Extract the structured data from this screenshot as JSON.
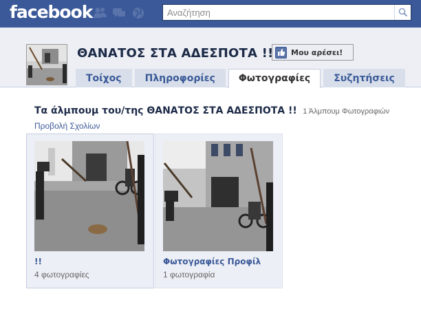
{
  "topbar": {
    "logo": "facebook",
    "search_placeholder": "Αναζήτηση",
    "icons": [
      "friend-requests-icon",
      "messages-icon",
      "notifications-globe-icon",
      "search-icon"
    ]
  },
  "page": {
    "title": "ΘΑΝΑΤΟΣ ΣΤΑ ΑΔΕΣΠΟΤΑ !!",
    "like_label": "Μου αρέσει!",
    "tabs": [
      {
        "label": "Τοίχος"
      },
      {
        "label": "Πληροφορίες"
      },
      {
        "label": "Φωτογραφίες"
      },
      {
        "label": "Συζητήσεις"
      }
    ],
    "active_tab": "Φωτογραφίες"
  },
  "albums": {
    "heading": "Τα άλμπουμ του/της ΘΑΝΑΤΟΣ ΣΤΑ ΑΔΕΣΠΟΤΑ !!",
    "album_count": "1 Άλμπουμ Φωτογραφιών",
    "view_comments": "Προβολή Σχολίων",
    "items": [
      {
        "title": "!!",
        "count": "4 φωτογραφίες"
      },
      {
        "title": "Φωτογραφίες Προφίλ",
        "count": "1 φωτογραφία"
      }
    ]
  },
  "colors": {
    "topbar": "#3b5998",
    "header_band": "#edeff4",
    "tab_inactive": "#d8dfea",
    "link": "#3b5998",
    "title_text": "#1c2a47"
  }
}
